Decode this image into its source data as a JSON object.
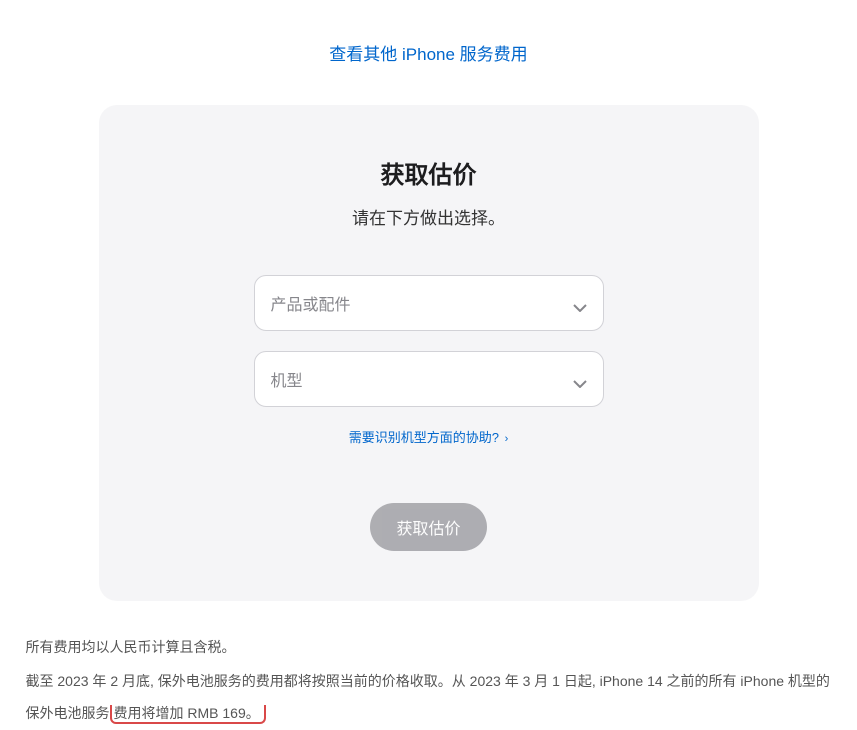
{
  "topLink": {
    "label": "查看其他 iPhone 服务费用"
  },
  "card": {
    "title": "获取估价",
    "subtitle": "请在下方做出选择。",
    "productSelect": {
      "placeholder": "产品或配件"
    },
    "modelSelect": {
      "placeholder": "机型"
    },
    "helpLink": {
      "label": "需要识别机型方面的协助?",
      "chevron": "›"
    },
    "submitButton": {
      "label": "获取估价"
    }
  },
  "footer": {
    "line1": "所有费用均以人民币计算且含税。",
    "line2_prefix": "截至 2023 年 2 月底, 保外电池服务的费用都将按照当前的价格收取。从 2023 年 3 月 1 日起, iPhone 14 之前的所有 iPhone 机型的保外电池服务",
    "line2_highlight": "费用将增加 RMB 169。"
  }
}
